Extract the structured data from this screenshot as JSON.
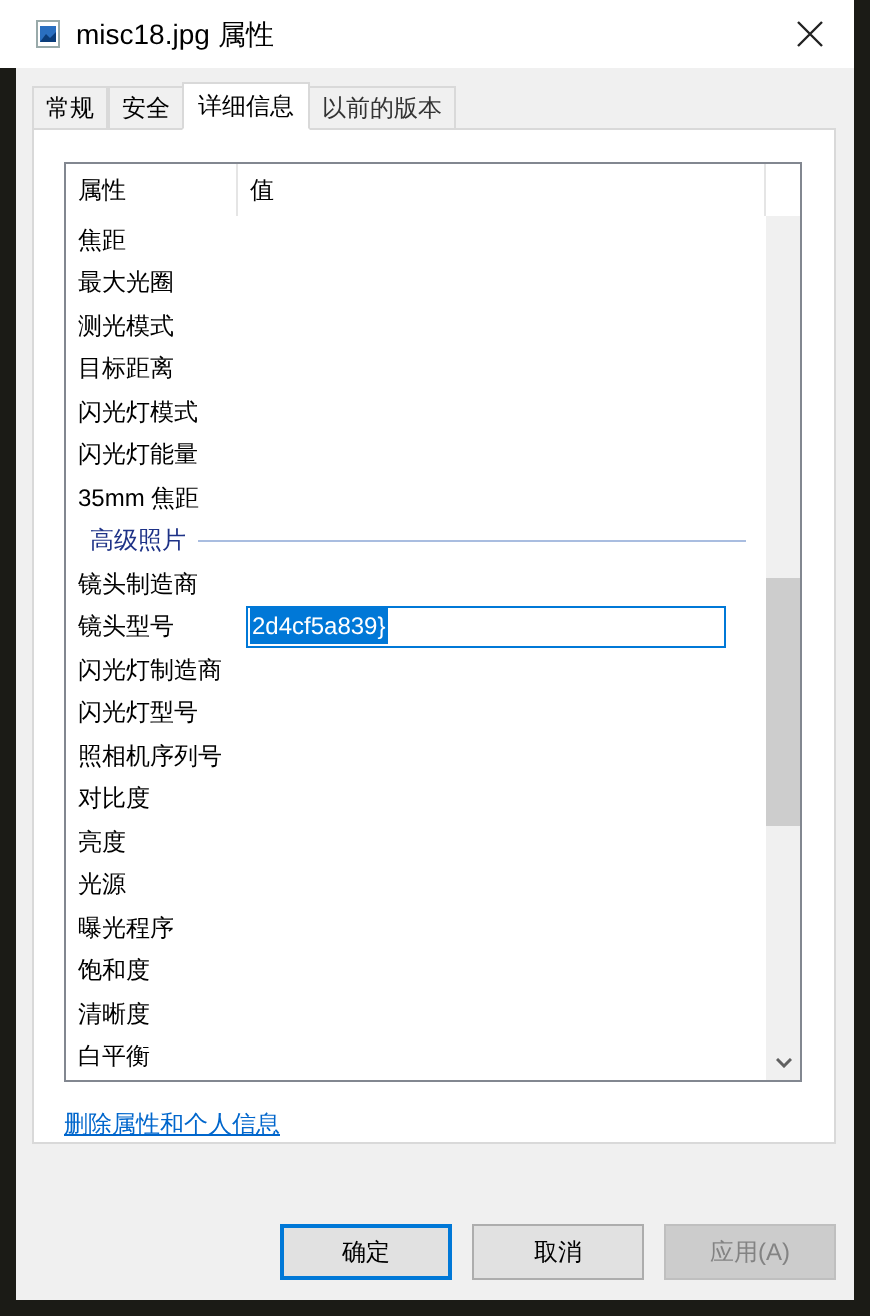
{
  "window": {
    "title": "misc18.jpg 属性"
  },
  "tabs": [
    {
      "label": "常规",
      "selected": false
    },
    {
      "label": "安全",
      "selected": false
    },
    {
      "label": "详细信息",
      "selected": true
    },
    {
      "label": "以前的版本",
      "selected": false
    }
  ],
  "table": {
    "columns": [
      "属性",
      "值"
    ],
    "rows": [
      {
        "kind": "property",
        "name": "焦距"
      },
      {
        "kind": "property",
        "name": "最大光圈"
      },
      {
        "kind": "property",
        "name": "测光模式"
      },
      {
        "kind": "property",
        "name": "目标距离"
      },
      {
        "kind": "property",
        "name": "闪光灯模式"
      },
      {
        "kind": "property",
        "name": "闪光灯能量"
      },
      {
        "kind": "property",
        "name": "35mm 焦距"
      },
      {
        "kind": "group",
        "name": "高级照片"
      },
      {
        "kind": "property",
        "name": "镜头制造商"
      },
      {
        "kind": "property",
        "name": "镜头型号",
        "value": "2d4cf5a839}",
        "editing": true
      },
      {
        "kind": "property",
        "name": "闪光灯制造商"
      },
      {
        "kind": "property",
        "name": "闪光灯型号"
      },
      {
        "kind": "property",
        "name": "照相机序列号"
      },
      {
        "kind": "property",
        "name": "对比度"
      },
      {
        "kind": "property",
        "name": "亮度"
      },
      {
        "kind": "property",
        "name": "光源"
      },
      {
        "kind": "property",
        "name": "曝光程序"
      },
      {
        "kind": "property",
        "name": "饱和度"
      },
      {
        "kind": "property",
        "name": "清晰度"
      },
      {
        "kind": "property",
        "name": "白平衡"
      }
    ]
  },
  "link": "删除属性和个人信息",
  "buttons": [
    {
      "label": "确定",
      "default": true,
      "disabled": false
    },
    {
      "label": "取消",
      "default": false,
      "disabled": false
    },
    {
      "label": "应用(A)",
      "default": false,
      "disabled": true
    }
  ]
}
